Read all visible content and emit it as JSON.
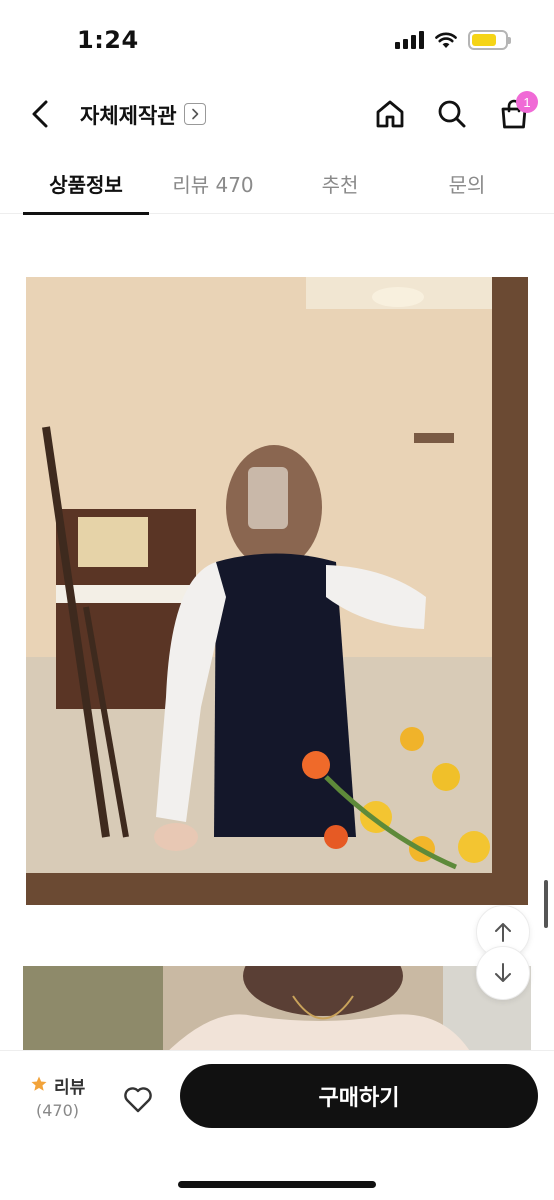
{
  "status_bar": {
    "time": "1:24"
  },
  "header": {
    "shop_name": "자체제작관"
  },
  "cart": {
    "badge_count": "1"
  },
  "tabs": [
    {
      "label": "상품정보",
      "active": true
    },
    {
      "label": "리뷰 470",
      "active": false
    },
    {
      "label": "추천",
      "active": false
    },
    {
      "label": "문의",
      "active": false
    }
  ],
  "bottom_bar": {
    "review_label": "리뷰",
    "review_count": "(470)",
    "buy_label": "구매하기"
  },
  "colors": {
    "accent_badge": "#f06ad6",
    "battery": "#f5d416",
    "star": "#f2a33a",
    "buy_button": "#111111"
  },
  "icons": [
    "back-arrow-icon",
    "chevron-right-icon",
    "home-icon",
    "search-icon",
    "shopping-bag-icon",
    "arrow-up-icon",
    "arrow-down-icon",
    "star-icon",
    "heart-icon"
  ]
}
